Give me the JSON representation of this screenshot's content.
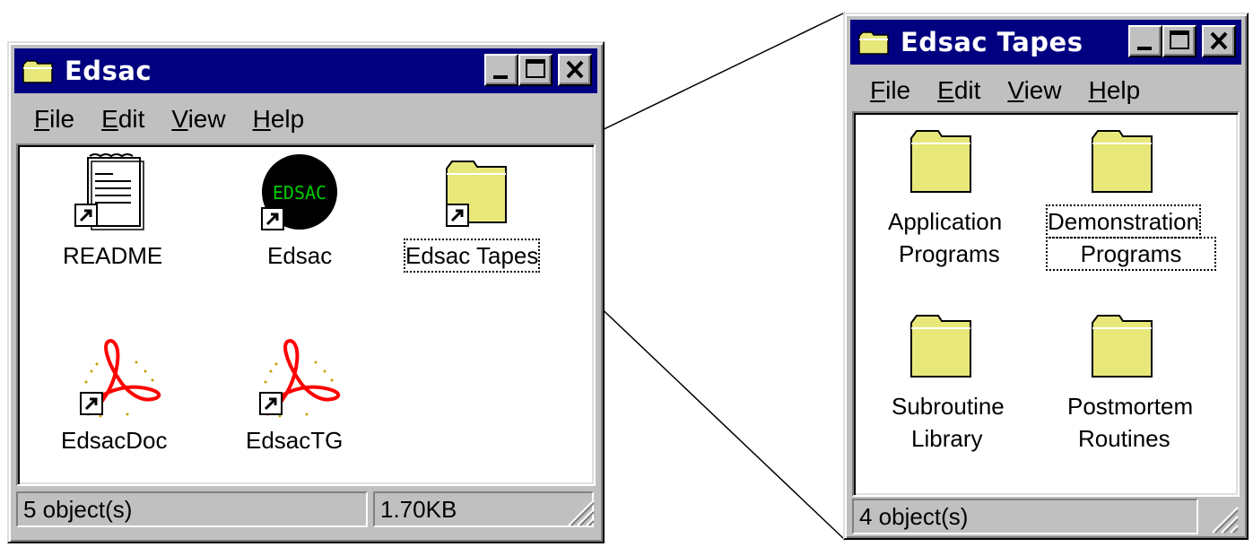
{
  "windows": {
    "edsac": {
      "title": "Edsac",
      "menu": [
        "File",
        "Edit",
        "View",
        "Help"
      ],
      "menu_underline": [
        "F",
        "E",
        "V",
        "H"
      ],
      "icons": [
        {
          "label": "README",
          "icon": "text-document-shortcut-icon"
        },
        {
          "label": "Edsac",
          "icon": "edsac-app-shortcut-icon"
        },
        {
          "label": "Edsac Tapes",
          "icon": "folder-shortcut-icon",
          "selected": true
        },
        {
          "label": "EdsacDoc",
          "icon": "acrobat-pdf-shortcut-icon"
        },
        {
          "label": "EdsacTG",
          "icon": "acrobat-pdf-shortcut-icon"
        }
      ],
      "status": {
        "objects": "5 object(s)",
        "size": "1.70KB"
      }
    },
    "tapes": {
      "title": "Edsac Tapes",
      "menu": [
        "File",
        "Edit",
        "View",
        "Help"
      ],
      "menu_underline": [
        "F",
        "E",
        "V",
        "H"
      ],
      "icons": [
        {
          "line1": "Application",
          "line2": "Programs",
          "icon": "folder-icon"
        },
        {
          "line1": "Demonstration",
          "line2": "Programs",
          "icon": "folder-icon",
          "selected": true
        },
        {
          "line1": "Subroutine",
          "line2": "Library",
          "icon": "folder-icon"
        },
        {
          "line1": "Postmortem",
          "line2": "Routines",
          "icon": "folder-icon"
        }
      ],
      "status": {
        "objects": "4 object(s)"
      }
    }
  },
  "icon_text": {
    "edsac_logo": "EDSAC"
  },
  "colors": {
    "titlebar": "#000080",
    "window_face": "#c0c0c0",
    "folder": "#e8e87a",
    "acrobat_red": "#ff0000",
    "edsac_green": "#00cc00"
  }
}
